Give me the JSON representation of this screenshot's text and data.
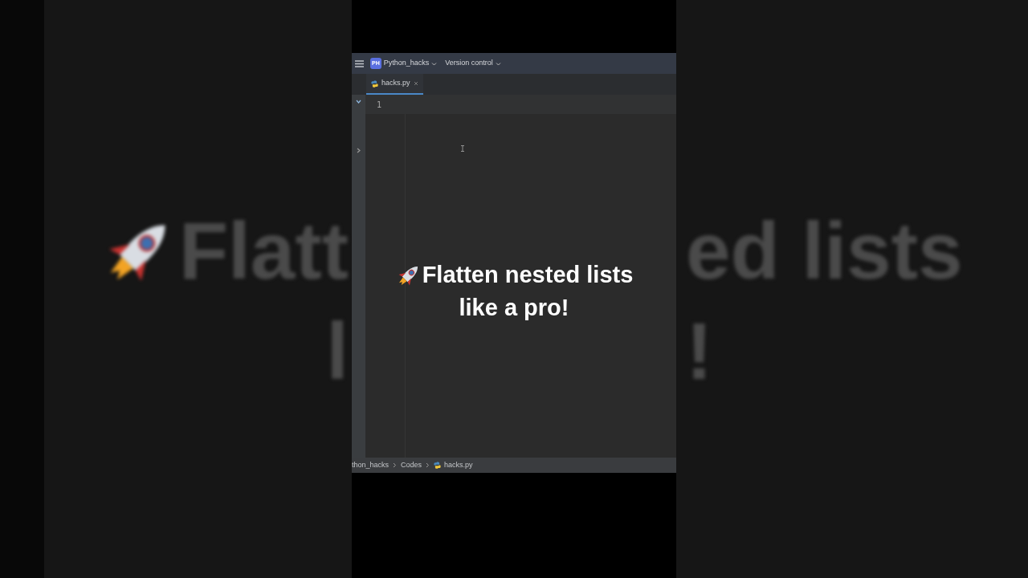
{
  "background_caption": {
    "left": [
      "Flatt",
      "l"
    ],
    "right": [
      "ed lists",
      "!"
    ]
  },
  "toolbar": {
    "project_badge": "PH",
    "project": "Python_hacks",
    "vcs": "Version control"
  },
  "tabs": [
    {
      "label": "hacks.py",
      "selected": true
    }
  ],
  "editor": {
    "line_numbers": [
      "1"
    ]
  },
  "caption": {
    "lines": [
      "Flatten nested lists",
      "like a pro!"
    ]
  },
  "breadcrumbs": [
    {
      "label": "thon_hacks",
      "kind": "folder"
    },
    {
      "label": "Codes",
      "kind": "folder"
    },
    {
      "label": "hacks.py",
      "kind": "file"
    }
  ]
}
